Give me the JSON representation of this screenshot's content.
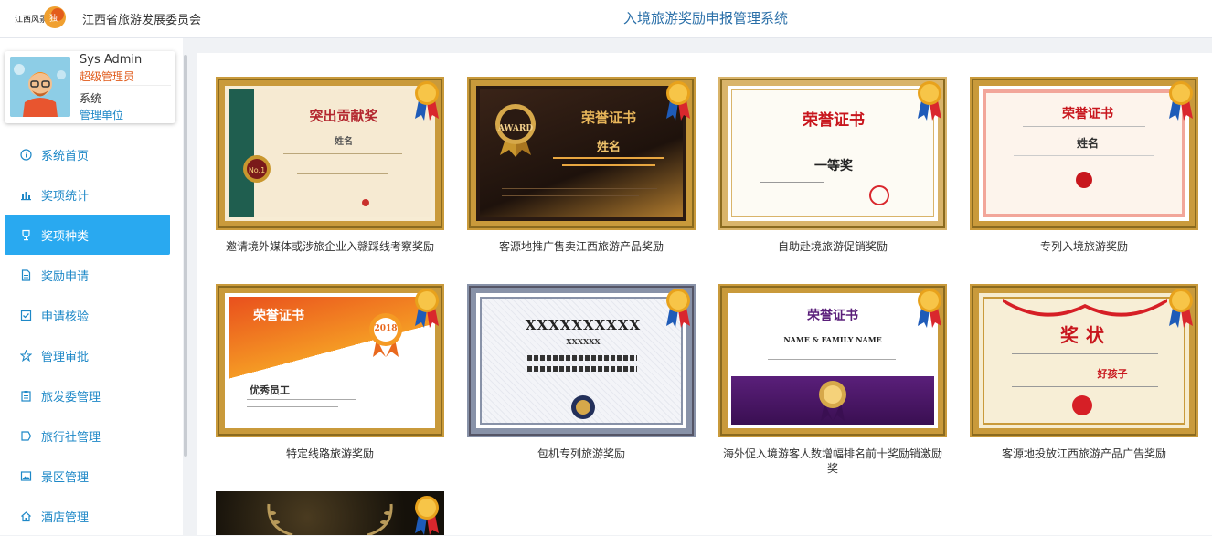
{
  "header": {
    "org_name": "江西省旅游发展委员会",
    "system_title": "入境旅游奖励申报管理系统"
  },
  "user": {
    "name": "Sys Admin",
    "role": "超级管理员",
    "label": "系统",
    "unit": "管理单位"
  },
  "menu": [
    {
      "label": "系统首页",
      "icon": "info-icon"
    },
    {
      "label": "奖项统计",
      "icon": "bar-chart-icon"
    },
    {
      "label": "奖项种类",
      "icon": "trophy-icon"
    },
    {
      "label": "奖励申请",
      "icon": "document-icon"
    },
    {
      "label": "申请核验",
      "icon": "checkbox-icon"
    },
    {
      "label": "管理审批",
      "icon": "star-icon"
    },
    {
      "label": "旅发委管理",
      "icon": "clipboard-icon"
    },
    {
      "label": "旅行社管理",
      "icon": "flag-icon"
    },
    {
      "label": "景区管理",
      "icon": "picture-icon"
    },
    {
      "label": "酒店管理",
      "icon": "home-icon"
    }
  ],
  "active_menu": "奖项种类",
  "awards": [
    {
      "caption": "邀请境外媒体或涉旅企业入赣踩线考察奖励",
      "cert_title": "突出贡献奖",
      "cert_name": "姓名"
    },
    {
      "caption": "客源地推广售卖江西旅游产品奖励",
      "cert_title": "荣誉证书",
      "cert_name": "姓名",
      "cert_badge": "AWARD"
    },
    {
      "caption": "自助赴境旅游促销奖励",
      "cert_title": "荣誉证书",
      "cert_name": "一等奖"
    },
    {
      "caption": "专列入境旅游奖励",
      "cert_title": "荣誉证书",
      "cert_name": "姓名"
    },
    {
      "caption": "特定线路旅游奖励",
      "cert_title": "荣誉证书",
      "cert_name": "优秀员工",
      "cert_badge": "2018"
    },
    {
      "caption": "包机专列旅游奖励",
      "cert_title": "XXXXXXXXXX",
      "cert_name": "XXXXXX"
    },
    {
      "caption": "海外促入境游客人数增幅排名前十奖励销激励奖",
      "cert_title": "荣誉证书",
      "cert_name": "NAME & FAMILY NAME"
    },
    {
      "caption": "客源地投放江西旅游产品广告奖励",
      "cert_title": "奖状",
      "cert_name": "好孩子"
    },
    {
      "caption": "",
      "cert_title": "",
      "cert_name": ""
    }
  ],
  "colors": {
    "accent": "#29a9f0",
    "link": "#1e88c7",
    "role": "#e05a1a",
    "frame_gold": "#c99a3b"
  }
}
